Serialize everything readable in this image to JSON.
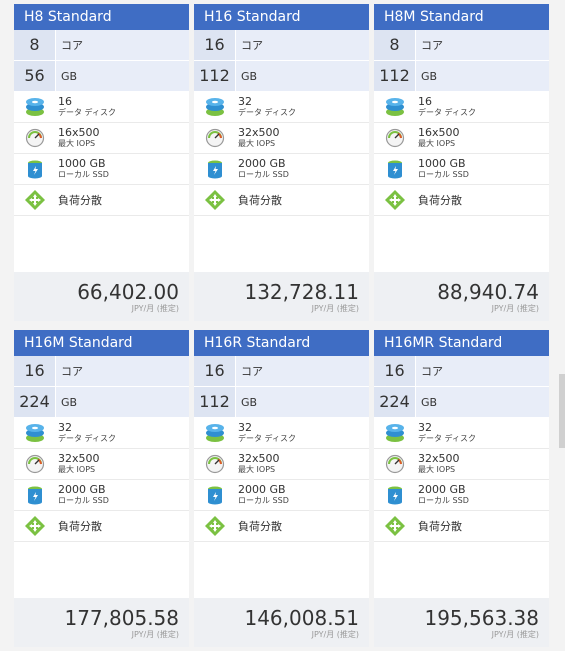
{
  "price_unit": "JPY/月 (推定)",
  "labels": {
    "core": "コア",
    "memory": "GB",
    "disk_sub": "データ ディスク",
    "iops_sub": "最大 IOPS",
    "ssd_sub": "ローカル SSD",
    "lb": "負荷分散"
  },
  "cards": [
    {
      "title": "H8 Standard",
      "cores": "8",
      "memory": "56",
      "disks": "16",
      "iops": "16x500",
      "ssd": "1000 GB",
      "price": "66,402.00"
    },
    {
      "title": "H16 Standard",
      "cores": "16",
      "memory": "112",
      "disks": "32",
      "iops": "32x500",
      "ssd": "2000 GB",
      "price": "132,728.11"
    },
    {
      "title": "H8M Standard",
      "cores": "8",
      "memory": "112",
      "disks": "16",
      "iops": "16x500",
      "ssd": "1000 GB",
      "price": "88,940.74"
    },
    {
      "title": "H16M Standard",
      "cores": "16",
      "memory": "224",
      "disks": "32",
      "iops": "32x500",
      "ssd": "2000 GB",
      "price": "177,805.58"
    },
    {
      "title": "H16R Standard",
      "cores": "16",
      "memory": "112",
      "disks": "32",
      "iops": "32x500",
      "ssd": "2000 GB",
      "price": "146,008.51"
    },
    {
      "title": "H16MR Standard",
      "cores": "16",
      "memory": "224",
      "disks": "32",
      "iops": "32x500",
      "ssd": "2000 GB",
      "price": "195,563.38"
    }
  ]
}
